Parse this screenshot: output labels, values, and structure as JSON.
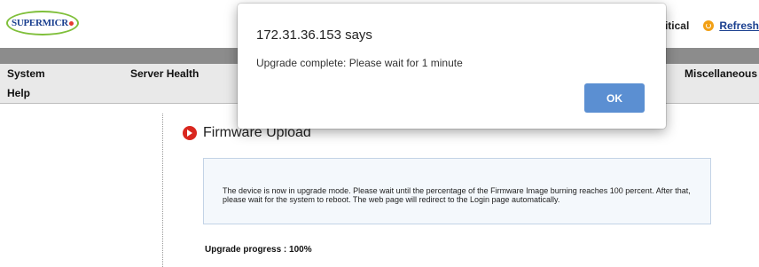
{
  "header": {
    "logo_text": "SUPERMICR",
    "critical_label": "Critical",
    "refresh_label": "Refresh"
  },
  "menu": {
    "row1": [
      "System",
      "Server Health",
      "Miscellaneous"
    ],
    "row2": [
      "Help"
    ]
  },
  "content": {
    "title": "Firmware Upload",
    "info_text": "The device is now in upgrade mode. Please wait until the percentage of the Firmware Image burning reaches 100 percent. After that, please wait for the system to reboot. The web page will redirect to the Login page automatically.",
    "progress_label": "Upgrade progress : 100%"
  },
  "dialog": {
    "origin": "172.31.36.153 says",
    "message": "Upgrade complete: Please wait for 1 minute",
    "ok_label": "OK"
  },
  "colors": {
    "menu_dark": "#8c8c8c",
    "menu_light": "#e9e9e9",
    "accent_blue": "#5b8fd2",
    "critical_red": "#d32f2f"
  }
}
